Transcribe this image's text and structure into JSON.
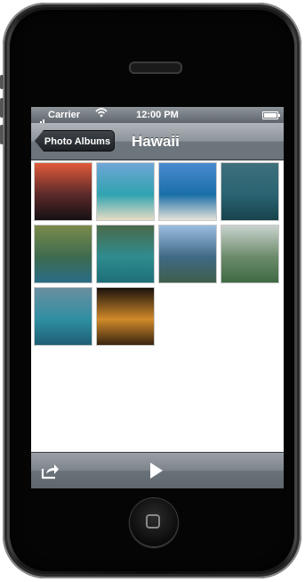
{
  "status_bar": {
    "carrier": "Carrier",
    "time": "12:00 PM"
  },
  "nav_bar": {
    "back_label": "Photo Albums",
    "title": "Hawaii"
  },
  "photos": [
    {
      "name": "sunset-clouds",
      "colors": [
        "#e05a3a",
        "#5c2a2a",
        "#151014"
      ]
    },
    {
      "name": "beach-turquoise",
      "colors": [
        "#6fa6d6",
        "#2fa3b0",
        "#e7dcc4"
      ]
    },
    {
      "name": "ocean-horizon",
      "colors": [
        "#4a8ad0",
        "#1a6fa8",
        "#e6e2d8"
      ]
    },
    {
      "name": "aerial-coast",
      "colors": [
        "#3e6f7c",
        "#2a6472",
        "#17434c"
      ]
    },
    {
      "name": "green-mountains",
      "colors": [
        "#7a8a4a",
        "#3e6b4f",
        "#2a6c86"
      ]
    },
    {
      "name": "aerial-reef",
      "colors": [
        "#4a6a4a",
        "#2f8c8f",
        "#1d6f78"
      ]
    },
    {
      "name": "cloudy-coast",
      "colors": [
        "#9bbde0",
        "#3f6a86",
        "#3f5e4a"
      ]
    },
    {
      "name": "valley-aerial",
      "colors": [
        "#c9d3cf",
        "#6c8b6a",
        "#3f6a44"
      ]
    },
    {
      "name": "coastline-waves",
      "colors": [
        "#6a8fa0",
        "#2f8fa2",
        "#1f5e74"
      ]
    },
    {
      "name": "golden-sunset",
      "colors": [
        "#1a120c",
        "#d08a2a",
        "#3a2410"
      ]
    }
  ],
  "icons": {
    "share": "share-icon",
    "play": "play-icon",
    "wifi": "wifi-icon",
    "signal": "signal-icon",
    "battery": "battery-icon"
  }
}
